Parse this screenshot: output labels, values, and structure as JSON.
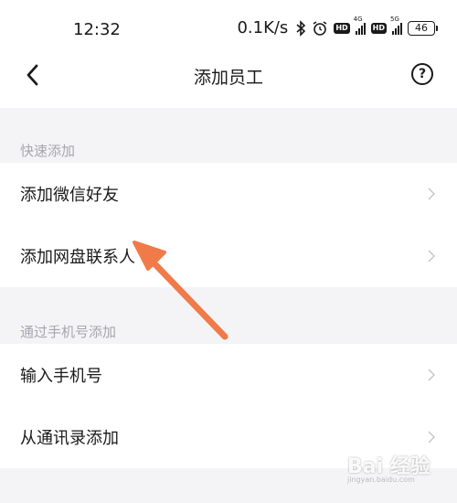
{
  "status_bar": {
    "time": "12:32",
    "speed": "0.1K/s",
    "hd1": "HD",
    "network1": "4G",
    "hd2": "HD",
    "network2": "5G",
    "battery": "46"
  },
  "nav": {
    "title": "添加员工",
    "help_symbol": "?"
  },
  "sections": [
    {
      "header": "快速添加",
      "items": [
        {
          "label": "添加微信好友"
        },
        {
          "label": "添加网盘联系人"
        }
      ]
    },
    {
      "header": "通过手机号添加",
      "items": [
        {
          "label": "输入手机号"
        },
        {
          "label": "从通讯录添加"
        }
      ]
    }
  ],
  "colors": {
    "arrow": "#f07a4a",
    "background": "#f4f4f6",
    "section_header_text": "#a6a6ad",
    "chevron": "#c4c4c8"
  },
  "watermark": {
    "text": "Bai 经验",
    "url": "jingyan.baidu.com"
  }
}
